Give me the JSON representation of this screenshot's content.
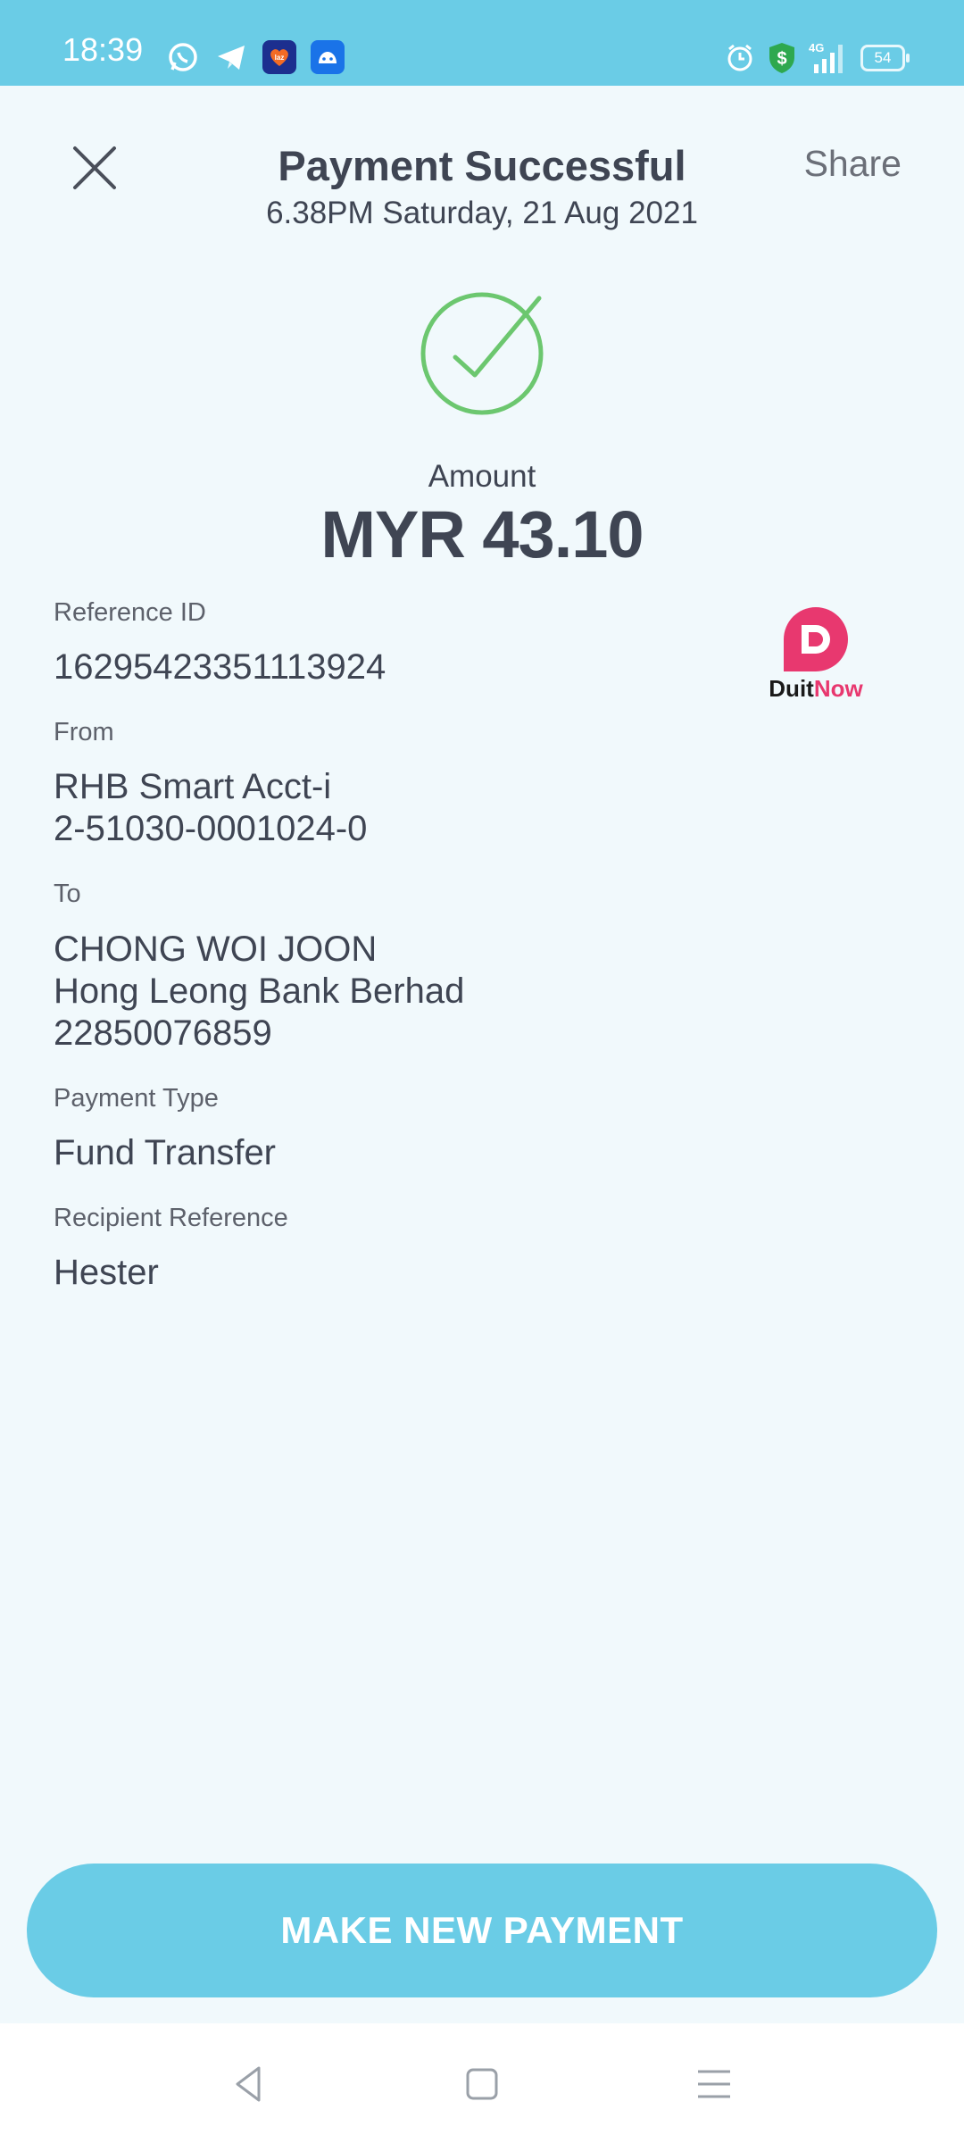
{
  "status_bar": {
    "time": "18:39",
    "battery": "54",
    "network": "4G",
    "icons_left": [
      "whatsapp-icon",
      "telegram-icon",
      "lazada-icon",
      "app-icon"
    ],
    "icons_right": [
      "alarm-icon",
      "shield-dollar-icon",
      "signal-icon",
      "battery-icon"
    ]
  },
  "header": {
    "title": "Payment Successful",
    "datetime": "6.38PM Saturday, 21 Aug 2021",
    "share_label": "Share"
  },
  "amount": {
    "label": "Amount",
    "value": "MYR 43.10"
  },
  "details": {
    "reference": {
      "label": "Reference ID",
      "value": "16295423351113924"
    },
    "from": {
      "label": "From",
      "lines": [
        "RHB Smart Acct-i",
        "2-51030-0001024-0"
      ]
    },
    "to": {
      "label": "To",
      "lines": [
        "CHONG WOI JOON",
        "Hong Leong Bank Berhad",
        "22850076859"
      ]
    },
    "payment_type": {
      "label": "Payment Type",
      "value": "Fund Transfer"
    },
    "recipient_reference": {
      "label": "Recipient Reference",
      "value": "Hester"
    }
  },
  "logo": {
    "part1": "Duit",
    "part2": "Now"
  },
  "cta": {
    "label": "MAKE NEW PAYMENT"
  },
  "colors": {
    "accent": "#6acce6",
    "success": "#6cc76f",
    "text": "#3f4553",
    "duitnow_pink": "#e8386f"
  }
}
